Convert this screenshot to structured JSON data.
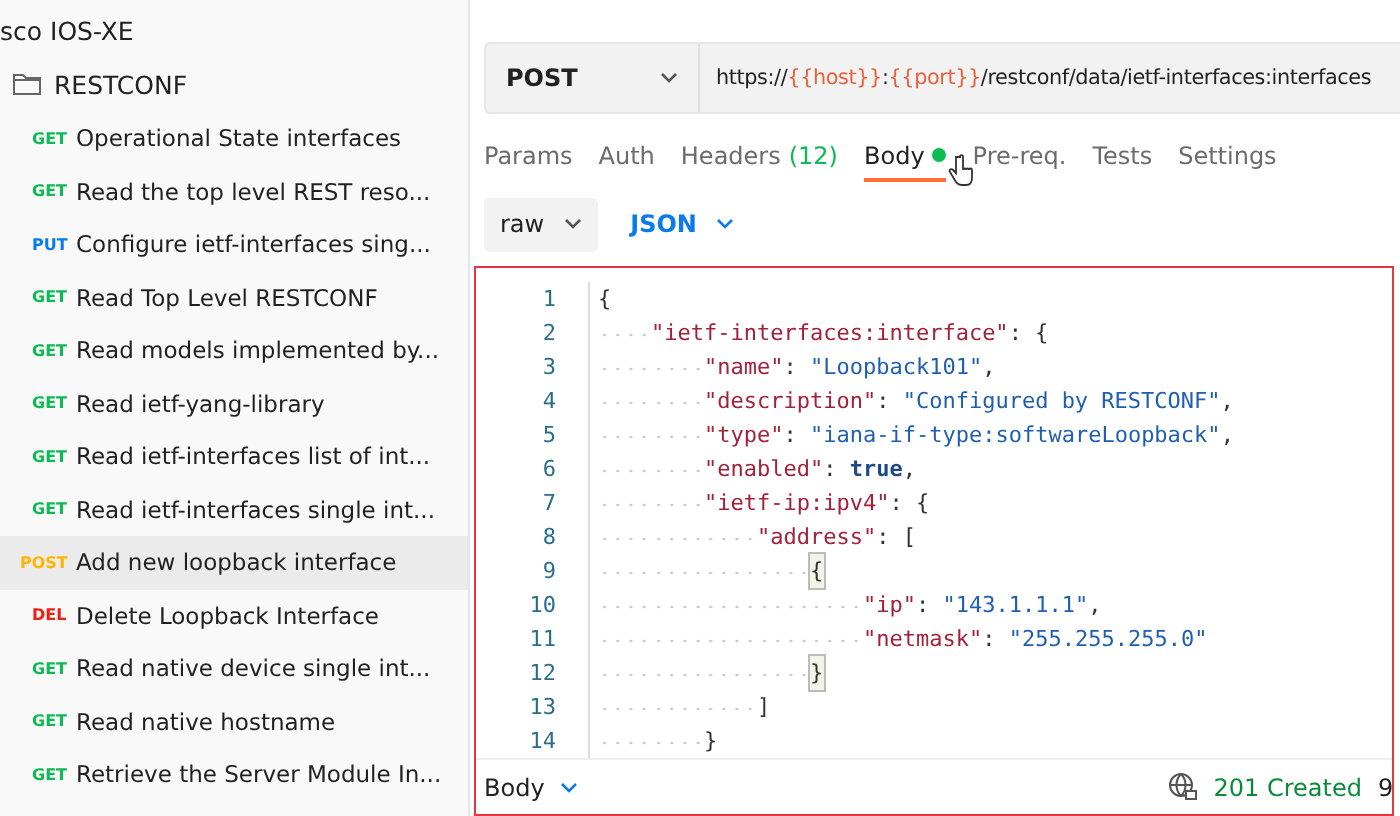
{
  "sidebar": {
    "collection": "sco IOS-XE",
    "folder": "RESTCONF",
    "items": [
      {
        "method": "GET",
        "color": "#0cbb52",
        "label": "Operational State interfaces",
        "selected": false
      },
      {
        "method": "GET",
        "color": "#0cbb52",
        "label": "Read the top level REST reso...",
        "selected": false
      },
      {
        "method": "PUT",
        "color": "#097bed",
        "label": "Configure ietf-interfaces sing...",
        "selected": false
      },
      {
        "method": "GET",
        "color": "#0cbb52",
        "label": "Read Top Level RESTCONF",
        "selected": false
      },
      {
        "method": "GET",
        "color": "#0cbb52",
        "label": "Read models implemented by...",
        "selected": false
      },
      {
        "method": "GET",
        "color": "#0cbb52",
        "label": "Read ietf-yang-library",
        "selected": false
      },
      {
        "method": "GET",
        "color": "#0cbb52",
        "label": "Read ietf-interfaces list of int...",
        "selected": false
      },
      {
        "method": "GET",
        "color": "#0cbb52",
        "label": "Read ietf-interfaces single int...",
        "selected": false
      },
      {
        "method": "POST",
        "color": "#ffb400",
        "label": "Add new loopback interface",
        "selected": true
      },
      {
        "method": "DEL",
        "color": "#eb2013",
        "label": "Delete Loopback Interface",
        "selected": false
      },
      {
        "method": "GET",
        "color": "#0cbb52",
        "label": "Read native device single int...",
        "selected": false
      },
      {
        "method": "GET",
        "color": "#0cbb52",
        "label": "Read native hostname",
        "selected": false
      },
      {
        "method": "GET",
        "color": "#0cbb52",
        "label": "Retrieve the Server Module In...",
        "selected": false
      }
    ]
  },
  "request": {
    "method": "POST",
    "url": [
      {
        "kind": "plain",
        "text": "https://"
      },
      {
        "kind": "variable",
        "text": "{{host}}"
      },
      {
        "kind": "plain",
        "text": ":"
      },
      {
        "kind": "variable",
        "text": "{{port}}"
      },
      {
        "kind": "plain",
        "text": "/restconf/data/ietf-interfaces:interfaces"
      }
    ]
  },
  "tabs": [
    {
      "label": "Params",
      "selected": false
    },
    {
      "label": "Auth",
      "selected": false
    },
    {
      "label": "Headers",
      "count": "(12)",
      "selected": false
    },
    {
      "label": "Body",
      "dot": true,
      "selected": true
    },
    {
      "label": "Pre-req.",
      "selected": false
    },
    {
      "label": "Tests",
      "selected": false
    },
    {
      "label": "Settings",
      "selected": false
    }
  ],
  "body_mode": "raw",
  "body_format": "JSON",
  "code": {
    "lines": [
      {
        "number": "1",
        "tokens": [
          {
            "kind": "punct",
            "text": "{"
          }
        ]
      },
      {
        "number": "2",
        "tokens": [
          {
            "kind": "indent"
          },
          {
            "kind": "key",
            "text": "\"ietf-interfaces:interface\""
          },
          {
            "kind": "punct",
            "text": ": {"
          }
        ]
      },
      {
        "number": "3",
        "tokens": [
          {
            "kind": "indent"
          },
          {
            "kind": "indent"
          },
          {
            "kind": "key",
            "text": "\"name\""
          },
          {
            "kind": "punct",
            "text": ": "
          },
          {
            "kind": "string",
            "text": "\"Loopback101\""
          },
          {
            "kind": "punct",
            "text": ","
          }
        ]
      },
      {
        "number": "4",
        "tokens": [
          {
            "kind": "indent"
          },
          {
            "kind": "indent"
          },
          {
            "kind": "key",
            "text": "\"description\""
          },
          {
            "kind": "punct",
            "text": ": "
          },
          {
            "kind": "string",
            "text": "\"Configured by RESTCONF\""
          },
          {
            "kind": "punct",
            "text": ","
          }
        ]
      },
      {
        "number": "5",
        "tokens": [
          {
            "kind": "indent"
          },
          {
            "kind": "indent"
          },
          {
            "kind": "key",
            "text": "\"type\""
          },
          {
            "kind": "punct",
            "text": ": "
          },
          {
            "kind": "string",
            "text": "\"iana-if-type:softwareLoopback\""
          },
          {
            "kind": "punct",
            "text": ","
          }
        ]
      },
      {
        "number": "6",
        "tokens": [
          {
            "kind": "indent"
          },
          {
            "kind": "indent"
          },
          {
            "kind": "key",
            "text": "\"enabled\""
          },
          {
            "kind": "punct",
            "text": ": "
          },
          {
            "kind": "bool",
            "text": "true"
          },
          {
            "kind": "punct",
            "text": ","
          }
        ]
      },
      {
        "number": "7",
        "tokens": [
          {
            "kind": "indent"
          },
          {
            "kind": "indent"
          },
          {
            "kind": "key",
            "text": "\"ietf-ip:ipv4\""
          },
          {
            "kind": "punct",
            "text": ": {"
          }
        ]
      },
      {
        "number": "8",
        "tokens": [
          {
            "kind": "indent"
          },
          {
            "kind": "indent"
          },
          {
            "kind": "indent"
          },
          {
            "kind": "key",
            "text": "\"address\""
          },
          {
            "kind": "punct",
            "text": ": ["
          }
        ]
      },
      {
        "number": "9",
        "tokens": [
          {
            "kind": "indent"
          },
          {
            "kind": "indent"
          },
          {
            "kind": "indent"
          },
          {
            "kind": "indent"
          },
          {
            "kind": "punct",
            "text": "{",
            "matched": true
          }
        ]
      },
      {
        "number": "10",
        "tokens": [
          {
            "kind": "indent"
          },
          {
            "kind": "indent"
          },
          {
            "kind": "indent"
          },
          {
            "kind": "indent"
          },
          {
            "kind": "indent"
          },
          {
            "kind": "key",
            "text": "\"ip\""
          },
          {
            "kind": "punct",
            "text": ": "
          },
          {
            "kind": "string",
            "text": "\"143.1.1.1\""
          },
          {
            "kind": "punct",
            "text": ","
          }
        ]
      },
      {
        "number": "11",
        "tokens": [
          {
            "kind": "indent"
          },
          {
            "kind": "indent"
          },
          {
            "kind": "indent"
          },
          {
            "kind": "indent"
          },
          {
            "kind": "indent"
          },
          {
            "kind": "key",
            "text": "\"netmask\""
          },
          {
            "kind": "punct",
            "text": ": "
          },
          {
            "kind": "string",
            "text": "\"255.255.255.0\""
          }
        ]
      },
      {
        "number": "12",
        "tokens": [
          {
            "kind": "indent"
          },
          {
            "kind": "indent"
          },
          {
            "kind": "indent"
          },
          {
            "kind": "indent"
          },
          {
            "kind": "punct",
            "text": "}",
            "matched": true
          }
        ]
      },
      {
        "number": "13",
        "tokens": [
          {
            "kind": "indent"
          },
          {
            "kind": "indent"
          },
          {
            "kind": "indent"
          },
          {
            "kind": "punct",
            "text": "]"
          }
        ]
      },
      {
        "number": "14",
        "tokens": [
          {
            "kind": "indent"
          },
          {
            "kind": "indent"
          },
          {
            "kind": "punct",
            "text": "}"
          }
        ]
      }
    ]
  },
  "response": {
    "label": "Body",
    "status": "201 Created",
    "time": "9"
  }
}
